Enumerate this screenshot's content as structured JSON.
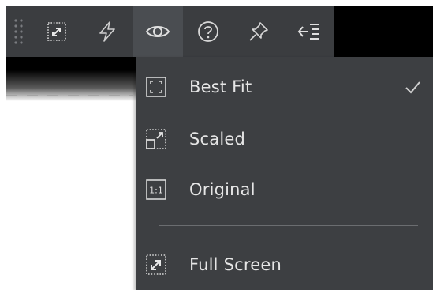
{
  "toolbar": {
    "buttons": [
      {
        "icon": "grip-handle-icon",
        "active": false
      },
      {
        "icon": "fit-to-screen-icon",
        "active": false
      },
      {
        "icon": "lightning-icon",
        "active": false
      },
      {
        "icon": "eye-icon",
        "active": true
      },
      {
        "icon": "help-circle-icon",
        "active": false
      },
      {
        "icon": "pin-icon",
        "active": false
      },
      {
        "icon": "collapse-menu-icon",
        "active": false
      }
    ]
  },
  "menu": {
    "items": [
      {
        "label": "Best Fit",
        "icon": "best-fit-icon",
        "checked": true
      },
      {
        "label": "Scaled",
        "icon": "scaled-icon",
        "checked": false
      },
      {
        "label": "Original",
        "icon": "original-size-icon",
        "icon_text": "1:1",
        "checked": false
      },
      {
        "label": "Full Screen",
        "icon": "full-screen-icon",
        "checked": false
      }
    ]
  },
  "colors": {
    "toolbar_bg": "#3b3d40",
    "toolbar_active": "#4a4d51",
    "menu_bg": "#3d3f42",
    "menu_text": "#e6e6e6",
    "icon_stroke": "#d8d8d8"
  }
}
